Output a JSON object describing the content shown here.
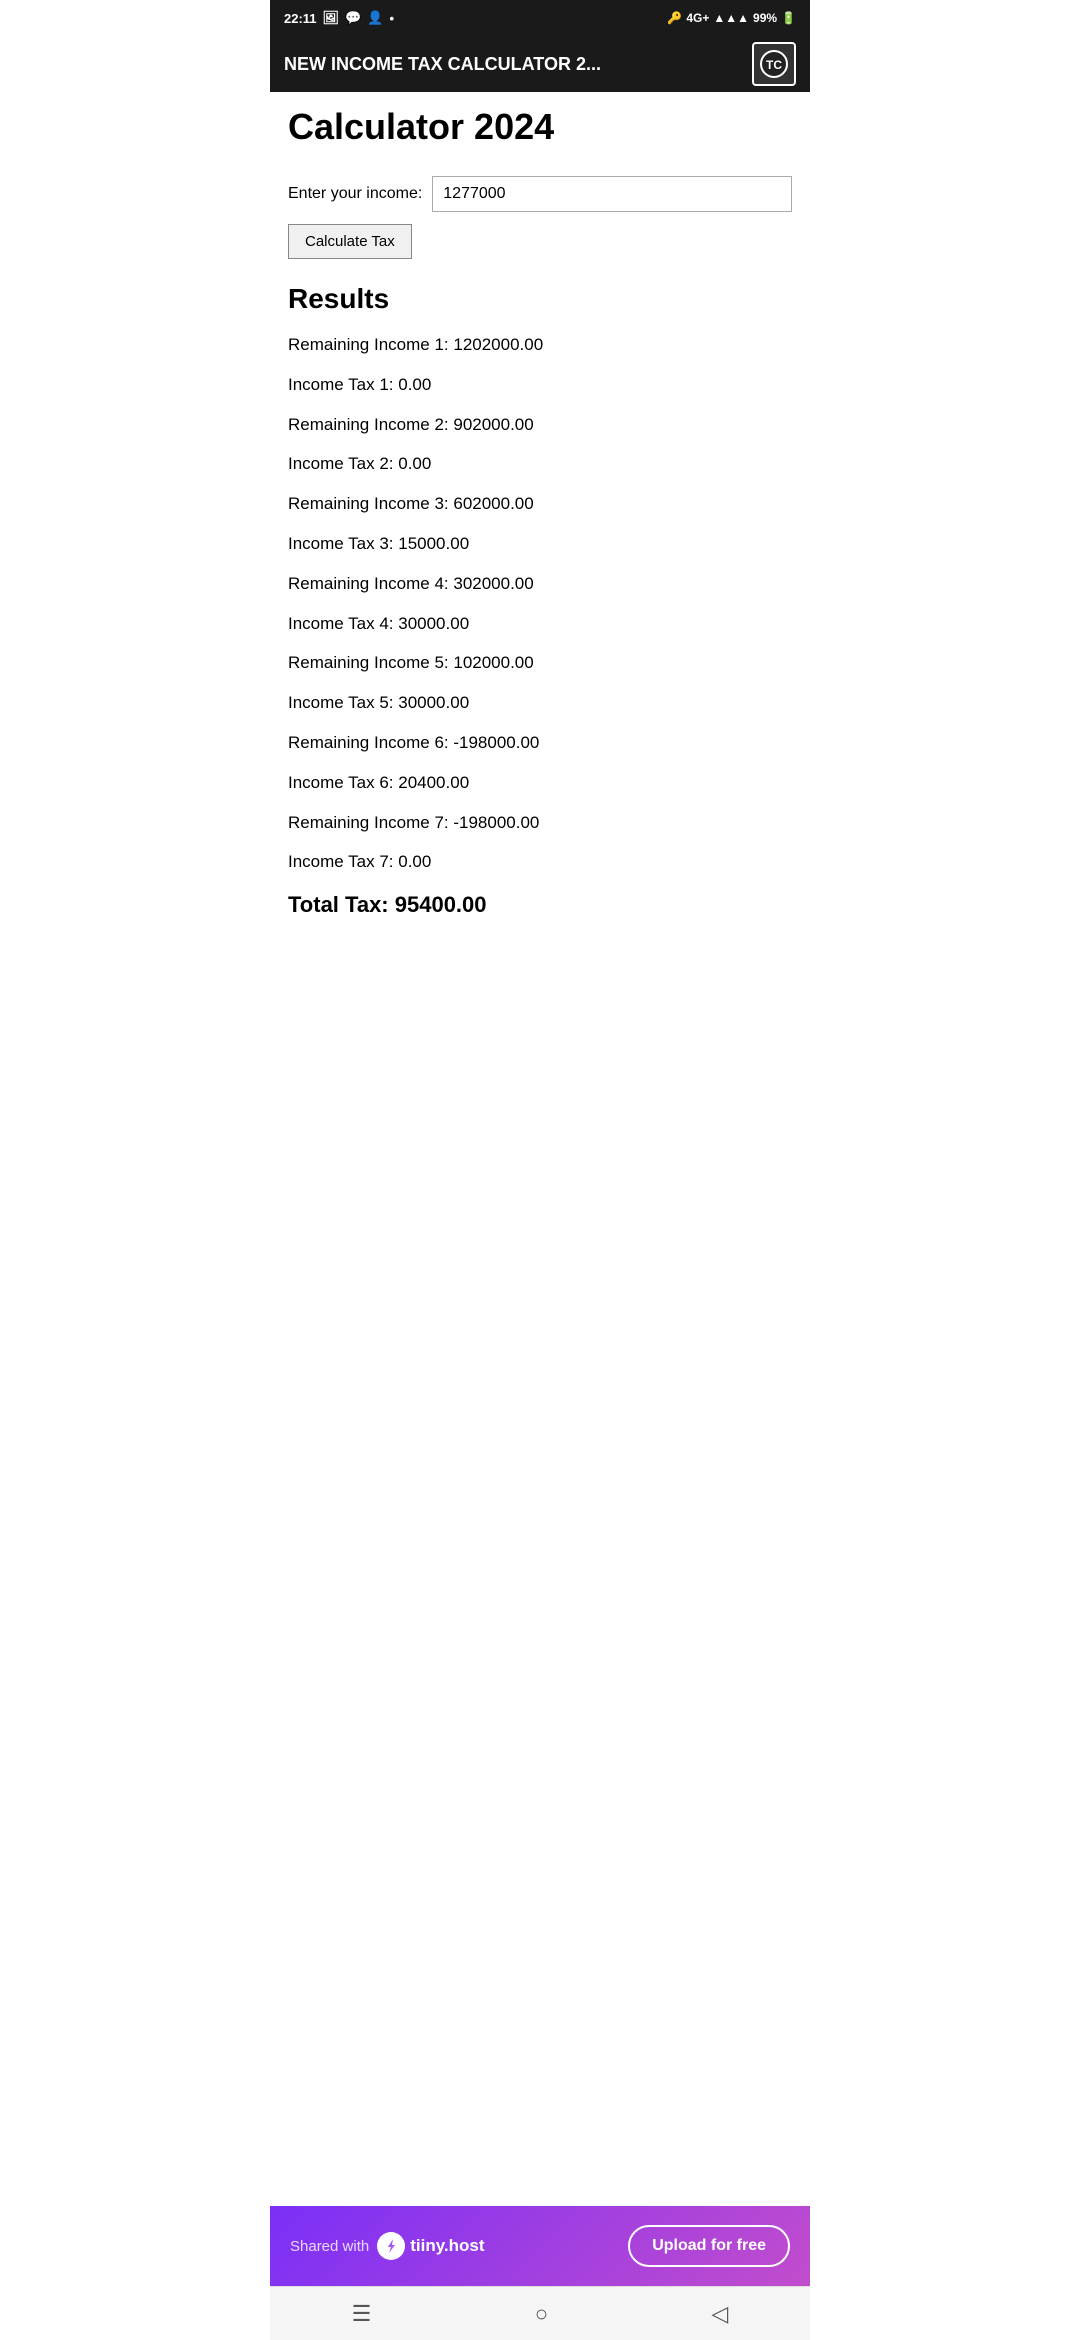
{
  "status_bar": {
    "time": "22:11",
    "battery": "99%",
    "network": "4G+"
  },
  "app_bar": {
    "title": "NEW INCOME TAX CALCULATOR 2...",
    "icon_label": "TC"
  },
  "page": {
    "title": "Calculator 2024",
    "input_label": "Enter your income:",
    "input_value": "1277000",
    "calculate_btn": "Calculate Tax",
    "results_heading": "Results"
  },
  "results": [
    {
      "label": "Remaining Income 1:",
      "value": "1202000.00"
    },
    {
      "label": "Income Tax 1:",
      "value": "0.00"
    },
    {
      "label": "Remaining Income 2:",
      "value": "902000.00"
    },
    {
      "label": "Income Tax 2:",
      "value": "0.00"
    },
    {
      "label": "Remaining Income 3:",
      "value": "602000.00"
    },
    {
      "label": "Income Tax 3:",
      "value": "15000.00"
    },
    {
      "label": "Remaining Income 4:",
      "value": "302000.00"
    },
    {
      "label": "Income Tax 4:",
      "value": "30000.00"
    },
    {
      "label": "Remaining Income 5:",
      "value": "102000.00"
    },
    {
      "label": "Income Tax 5:",
      "value": "30000.00"
    },
    {
      "label": "Remaining Income 6:",
      "value": "-198000.00"
    },
    {
      "label": "Income Tax 6:",
      "value": "20400.00"
    },
    {
      "label": "Remaining Income 7:",
      "value": "-198000.00"
    },
    {
      "label": "Income Tax 7:",
      "value": "0.00"
    }
  ],
  "total_tax": {
    "label": "Total Tax:",
    "value": "95400.00"
  },
  "banner": {
    "shared_with": "Shared with",
    "brand_name": "tiiny.host",
    "upload_btn": "Upload for free"
  },
  "nav": {
    "back_icon": "◁",
    "home_icon": "○",
    "menu_icon": "☰"
  }
}
